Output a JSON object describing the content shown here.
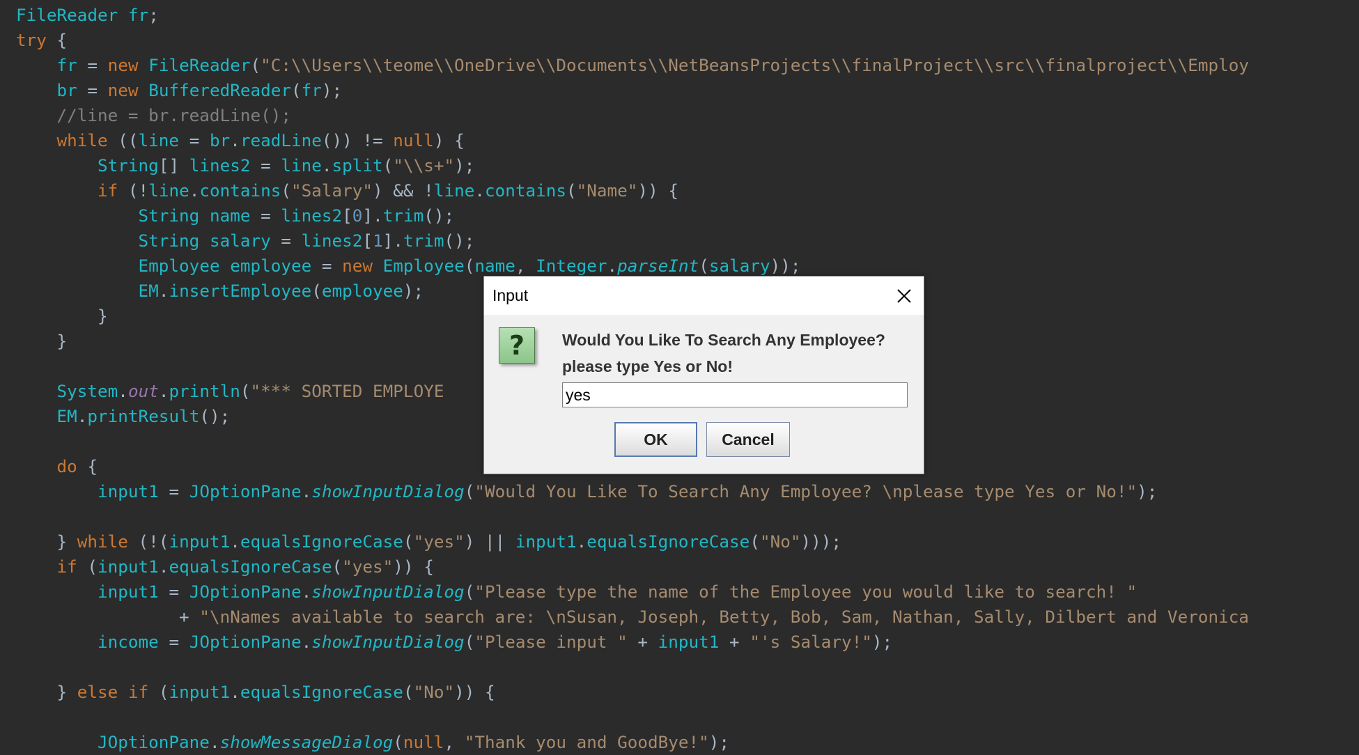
{
  "editor": {
    "lines": [
      "FileReader fr;",
      "try {",
      "    fr = new FileReader(\"C:\\\\Users\\\\teome\\\\OneDrive\\\\Documents\\\\NetBeansProjects\\\\finalProject\\\\src\\\\finalproject\\\\Employ",
      "    br = new BufferedReader(fr);",
      "    //line = br.readLine();",
      "    while ((line = br.readLine()) != null) {",
      "        String[] lines2 = line.split(\"\\\\s+\");",
      "        if (!line.contains(\"Salary\") && !line.contains(\"Name\")) {",
      "            String name = lines2[0].trim();",
      "            String salary = lines2[1].trim();",
      "            Employee employee = new Employee(name, Integer.parseInt(salary));",
      "            EM.insertEmployee(employee);",
      "        }",
      "    }",
      "",
      "    System.out.println(\"*** SORTED EMPLOYE",
      "    EM.printResult();",
      "",
      "    do {",
      "        input1 = JOptionPane.showInputDialog(\"Would You Like To Search Any Employee? \\nplease type Yes or No!\");",
      "",
      "    } while (!(input1.equalsIgnoreCase(\"yes\") || input1.equalsIgnoreCase(\"No\")));",
      "    if (input1.equalsIgnoreCase(\"yes\")) {",
      "        input1 = JOptionPane.showInputDialog(\"Please type the name of the Employee you would like to search! \"",
      "                + \"\\nNames available to search are: \\nSusan, Joseph, Betty, Bob, Sam, Nathan, Sally, Dilbert and Veronica",
      "        income = JOptionPane.showInputDialog(\"Please input \" + input1 + \"'s Salary!\");",
      "",
      "    } else if (input1.equalsIgnoreCase(\"No\")) {",
      "",
      "        JOptionPane.showMessageDialog(null, \"Thank you and GoodBye!\");"
    ]
  },
  "dialog": {
    "title": "Input",
    "close_icon": "close-icon",
    "question_icon": "?",
    "message_line1": "Would You Like To Search Any Employee?",
    "message_line2": "please type Yes or No!",
    "input_value": "yes",
    "ok_label": "OK",
    "cancel_label": "Cancel"
  },
  "colors": {
    "background": "#2b2b2b",
    "keyword": "#cc7832",
    "identifier": "#21b7c5",
    "string": "#a68b6e",
    "comment": "#808080"
  }
}
